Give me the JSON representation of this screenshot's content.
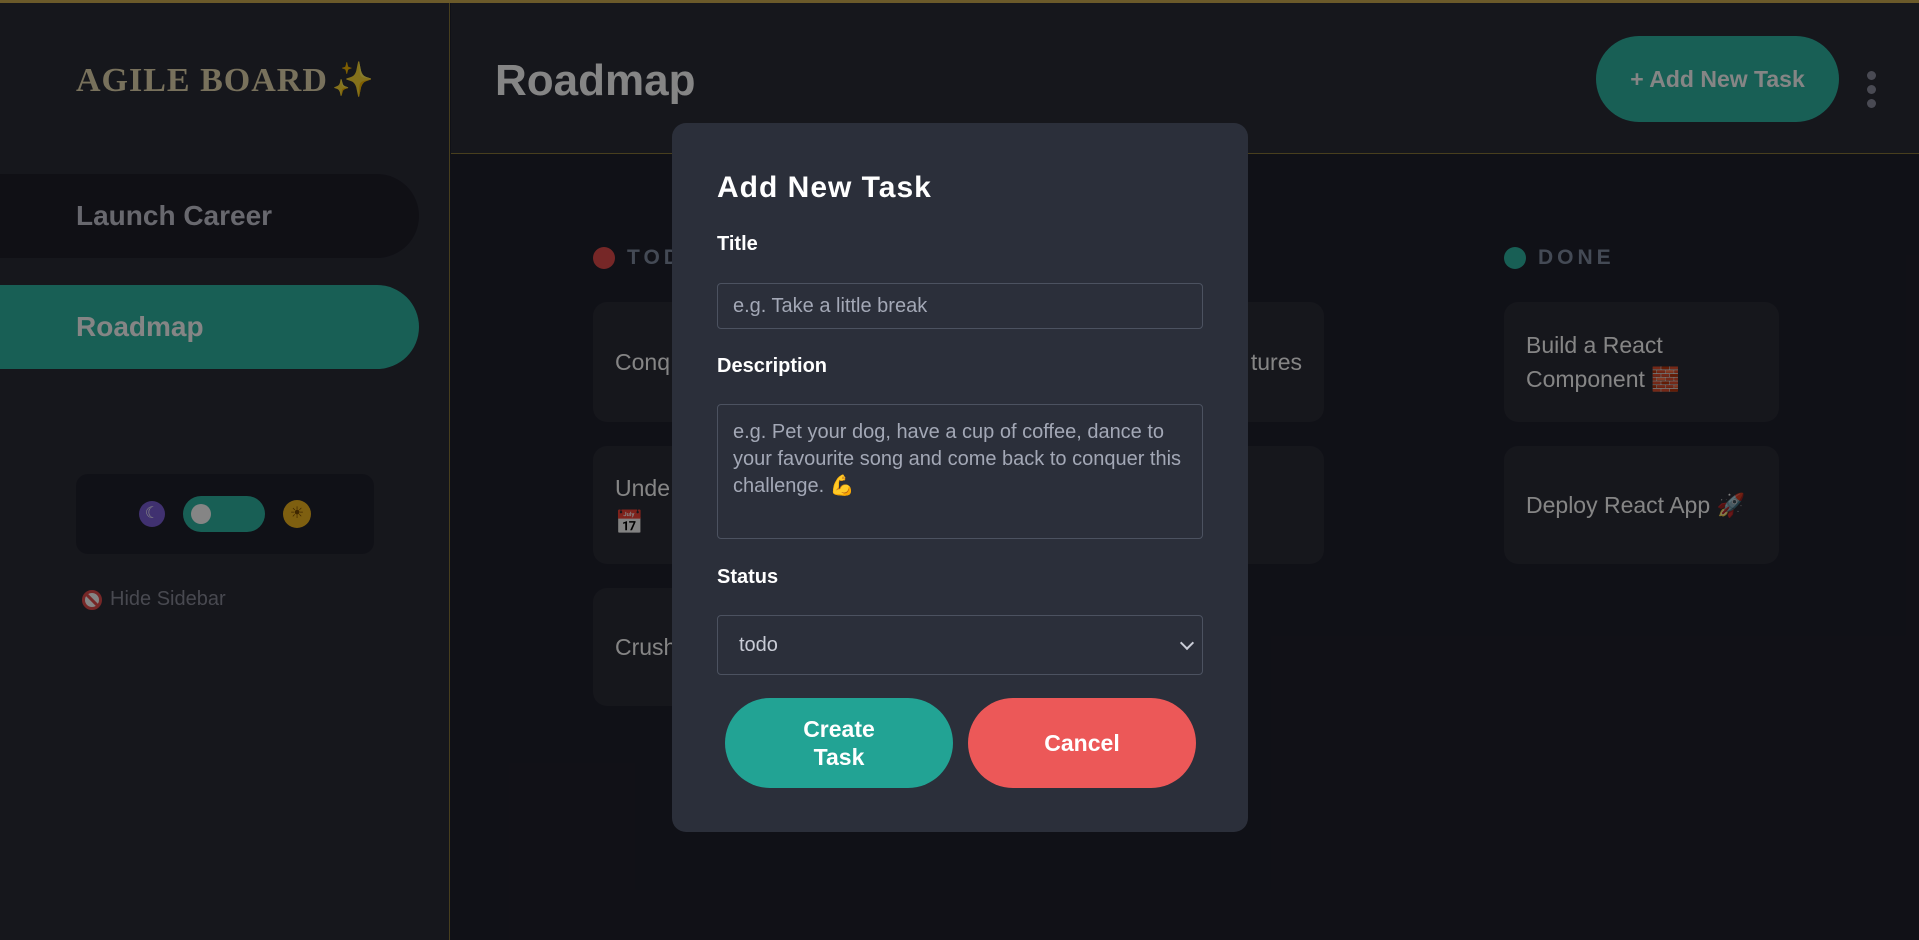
{
  "colors": {
    "accent": "#2eb6a3",
    "danger": "#ec5858",
    "todo_dot": "#e34b4b",
    "done_dot": "#2eb6a3"
  },
  "sidebar": {
    "logo": "AGILE BOARD",
    "logo_icon": "✨",
    "items": [
      {
        "label": "Launch Career"
      },
      {
        "label": "Roadmap"
      }
    ],
    "theme_toggle": {
      "dark_icon": "moon-icon",
      "light_icon": "sun-icon",
      "moon": "🌚",
      "sun": "🌞"
    },
    "hide_label": "Hide Sidebar"
  },
  "header": {
    "title": "Roadmap",
    "add_button": "+ Add New Task"
  },
  "board": {
    "columns": [
      {
        "title": "TODO",
        "cards": [
          "Conq",
          "Unde",
          "📅",
          "Crush"
        ]
      },
      {
        "title": "",
        "cards": [
          "tures"
        ]
      },
      {
        "title": "DONE",
        "cards": [
          "Build a React Component 🧱",
          "Deploy React App 🚀"
        ]
      }
    ]
  },
  "modal": {
    "title": "Add New Task",
    "title_label": "Title",
    "title_placeholder": "e.g. Take a little break",
    "description_label": "Description",
    "description_placeholder": "e.g. Pet your dog, have a cup of coffee, dance to your favourite song and come back to conquer this challenge. 💪",
    "status_label": "Status",
    "status_value": "todo",
    "create_button": "Create Task",
    "cancel_button": "Cancel"
  }
}
